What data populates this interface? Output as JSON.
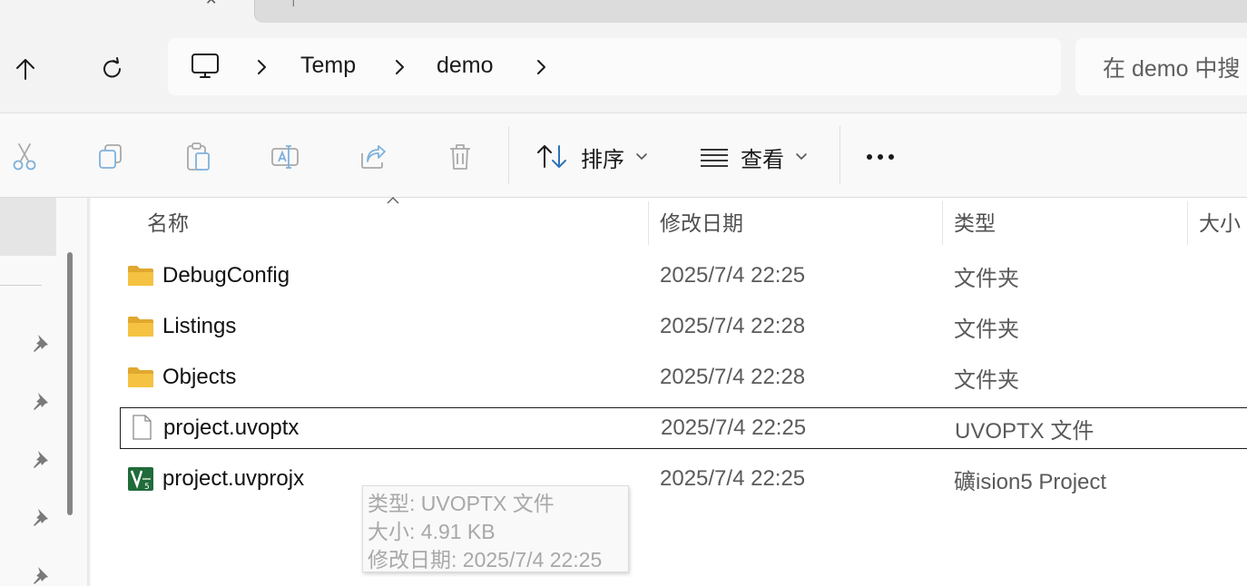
{
  "address": {
    "segments": [
      "Temp",
      "demo"
    ]
  },
  "search": {
    "placeholder": "在 demo 中搜"
  },
  "toolbar": {
    "sort_label": "排序",
    "view_label": "查看"
  },
  "columns": {
    "name": "名称",
    "modified": "修改日期",
    "type": "类型",
    "size": "大小"
  },
  "files": [
    {
      "name": "DebugConfig",
      "modified": "2025/7/4 22:25",
      "type": "文件夹",
      "icon": "folder-icon"
    },
    {
      "name": "Listings",
      "modified": "2025/7/4 22:28",
      "type": "文件夹",
      "icon": "folder-icon"
    },
    {
      "name": "Objects",
      "modified": "2025/7/4 22:28",
      "type": "文件夹",
      "icon": "folder-icon"
    },
    {
      "name": "project.uvoptx",
      "modified": "2025/7/4 22:25",
      "type": "UVOPTX 文件",
      "icon": "file-icon"
    },
    {
      "name": "project.uvprojx",
      "modified": "2025/7/4 22:25",
      "type": "礦ision5 Project",
      "icon": "uvision-icon"
    }
  ],
  "tooltip": {
    "type_line": "类型: UVOPTX 文件",
    "size_line": "大小: 4.91 KB",
    "modified_line": "修改日期: 2025/7/4 22:25"
  },
  "colors": {
    "folder": "#f5c242",
    "folder_dark": "#e0a82e",
    "icon_blue": "#6aa7d8",
    "uvision_green": "#1f6b3a"
  }
}
